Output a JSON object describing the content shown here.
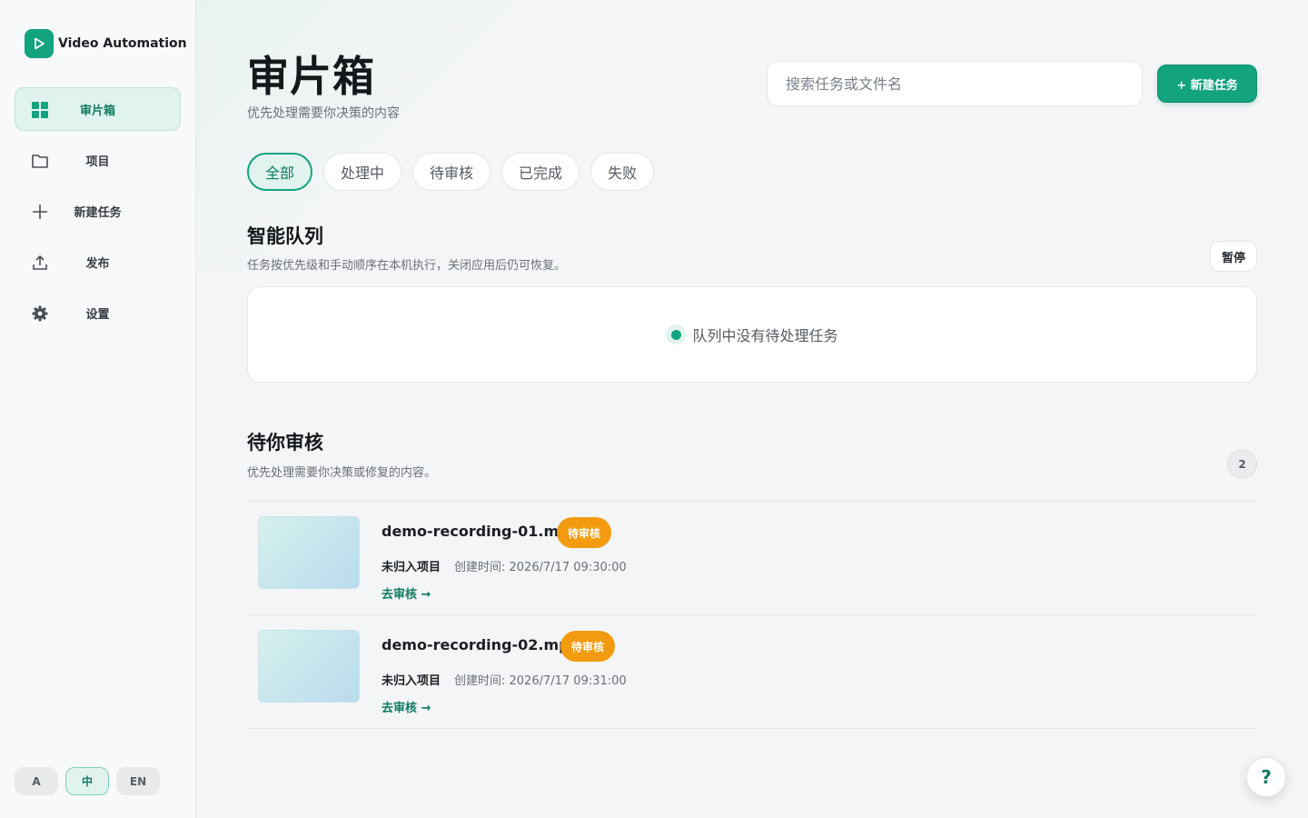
{
  "app": {
    "name": "Video Automation",
    "accent": "#13a37f"
  },
  "sidebar": {
    "items": [
      {
        "label": "审片箱",
        "icon": "grid-icon",
        "active": true
      },
      {
        "label": "项目",
        "icon": "folder-icon"
      },
      {
        "label": "新建任务",
        "icon": "plus-icon"
      },
      {
        "label": "发布",
        "icon": "upload-icon"
      },
      {
        "label": "设置",
        "icon": "gear-icon"
      }
    ],
    "lang": [
      "A",
      "中",
      "EN"
    ],
    "lang_active": "中"
  },
  "header": {
    "title": "审片箱",
    "subtitle": "优先处理需要你决策的内容",
    "search_placeholder": "搜索任务或文件名",
    "new_task_label": "+ 新建任务"
  },
  "filters": [
    "全部",
    "处理中",
    "待审核",
    "已完成",
    "失败"
  ],
  "queue": {
    "title": "智能队列",
    "desc": "任务按优先级和手动顺序在本机执行，关闭应用后仍可恢复。",
    "pause_label": "暂停",
    "empty_text": "队列中没有待处理任务"
  },
  "review": {
    "title": "待你审核",
    "desc": "优先处理需要你决策或修复的内容。",
    "count": "2",
    "items": [
      {
        "name": "demo-recording-01.mp4",
        "status": "待审核",
        "project": "未归入项目",
        "created": "创建时间: 2026/7/17 09:30:00",
        "action": "去审核 →"
      },
      {
        "name": "demo-recording-02.mp4",
        "status": "待审核",
        "project": "未归入项目",
        "created": "创建时间: 2026/7/17 09:31:00",
        "action": "去审核 →"
      }
    ]
  },
  "help_label": "?"
}
